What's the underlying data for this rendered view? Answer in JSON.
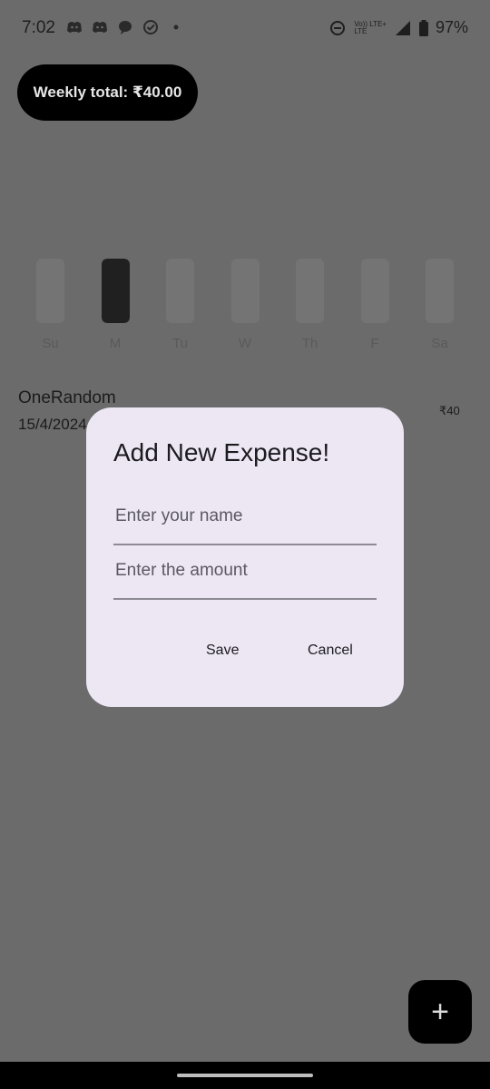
{
  "status_bar": {
    "time": "7:02",
    "network_top": "Vo)) LTE+",
    "network_bottom": "LTE",
    "battery": "97%"
  },
  "header": {
    "weekly_total": "Weekly total: ₹40.00"
  },
  "chart_data": {
    "type": "bar",
    "categories": [
      "Su",
      "M",
      "Tu",
      "W",
      "Th",
      "F",
      "Sa"
    ],
    "values": [
      0,
      40,
      0,
      0,
      0,
      0,
      0
    ],
    "ylim": [
      0,
      40
    ]
  },
  "expense": {
    "name": "OneRandom",
    "date": "15/4/2024",
    "amount": "₹40"
  },
  "dialog": {
    "title": "Add New Expense!",
    "name_placeholder": "Enter your name",
    "amount_placeholder": "Enter the amount",
    "save_label": "Save",
    "cancel_label": "Cancel"
  },
  "fab": {
    "icon": "plus-icon",
    "label": "+"
  }
}
